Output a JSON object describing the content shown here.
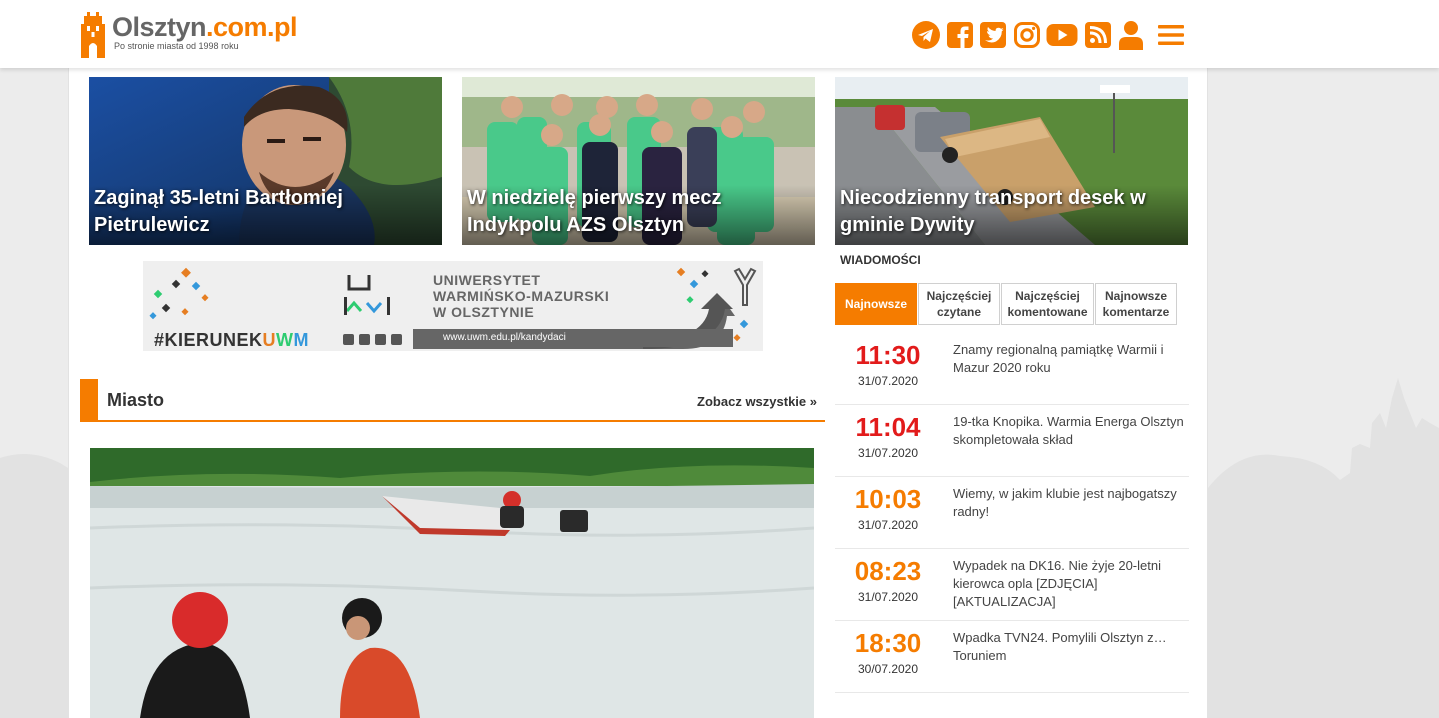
{
  "site": {
    "name_main": "Olsztyn",
    "name_domain": ".com.pl",
    "tagline": "Po stronie miasta od 1998 roku"
  },
  "header_icons": [
    "telegram-icon",
    "facebook-icon",
    "twitter-icon",
    "instagram-icon",
    "youtube-icon",
    "rss-icon",
    "user-icon",
    "menu-icon"
  ],
  "colors": {
    "accent": "#f57c00",
    "time_red": "#e21b1b",
    "time_orange": "#f57c00"
  },
  "top_stories": [
    {
      "title": "Zaginął 35-letni Bartłomiej Pietrulewicz"
    },
    {
      "title": "W niedzielę pierwszy mecz Indykpolu AZS Olsztyn"
    },
    {
      "title": "Niecodzienny transport desek w gminie Dywity"
    }
  ],
  "banner": {
    "uni_line1": "UNIWERSYTET",
    "uni_line2": "WARMIŃSKO-MAZURSKI",
    "uni_line3": "W OLSZTYNIE",
    "hashtag_a": "#KIERUNEK",
    "hashtag_u": "U",
    "hashtag_w": "W",
    "hashtag_m": "M",
    "url": "www.uwm.edu.pl/kandydaci"
  },
  "section": {
    "title": "Miasto",
    "more": "Zobacz wszystkie »"
  },
  "news": {
    "label": "WIADOMOŚCI",
    "tabs": [
      {
        "label": "Najnowsze"
      },
      {
        "label": "Najczęściej czytane"
      },
      {
        "label": "Najczęściej komentowane"
      },
      {
        "label": "Najnowsze komentarze"
      }
    ],
    "items": [
      {
        "time": "11:30",
        "date": "31/07.2020",
        "headline": "Znamy regionalną pamiątkę Warmii i Mazur 2020 roku",
        "color": "#e21b1b"
      },
      {
        "time": "11:04",
        "date": "31/07.2020",
        "headline": "19-tka Knopika. Warmia Energa Olsztyn skompletowała skład",
        "color": "#e21b1b"
      },
      {
        "time": "10:03",
        "date": "31/07.2020",
        "headline": "Wiemy, w jakim klubie jest najbogatszy radny!",
        "color": "#f57c00"
      },
      {
        "time": "08:23",
        "date": "31/07.2020",
        "headline": "Wypadek na DK16. Nie żyje 20-letni kierowca opla [ZDJĘCIA] [AKTUALIZACJA]",
        "color": "#f57c00"
      },
      {
        "time": "18:30",
        "date": "30/07.2020",
        "headline": "Wpadka TVN24. Pomylili Olsztyn z… Toruniem",
        "color": "#f57c00"
      }
    ]
  }
}
